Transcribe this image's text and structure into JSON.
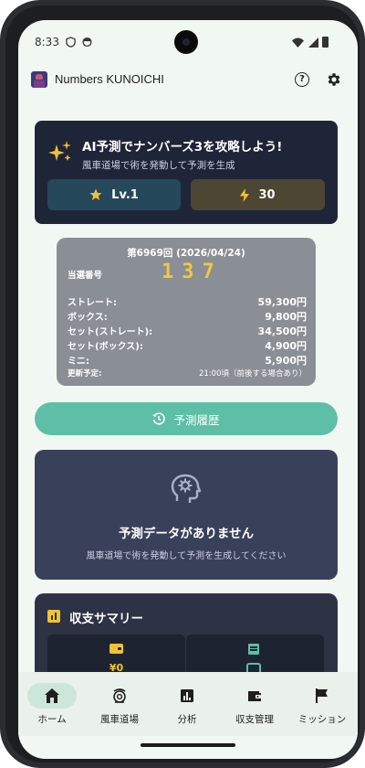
{
  "status_bar": {
    "time": "8:33"
  },
  "app_bar": {
    "title": "Numbers KUNOICHI",
    "help_icon": "help-circle-icon",
    "settings_icon": "gear-icon"
  },
  "hero": {
    "title": "AI予測でナンバーズ3を攻略しよう!",
    "subtitle": "風車道場で術を発動して予測を生成",
    "level_label": "Lv.1",
    "energy_value": "30",
    "colors": {
      "card": "#1f2538",
      "level_btn": "#25485a",
      "energy_btn": "#4c4633"
    }
  },
  "result": {
    "round": "第6969回 (2026/04/24)",
    "winning_label": "当選番号",
    "winning_number": "137",
    "prizes": [
      {
        "label": "ストレート:",
        "value": "59,300円"
      },
      {
        "label": "ボックス:",
        "value": "9,800円"
      },
      {
        "label": "セット(ストレート):",
        "value": "34,500円"
      },
      {
        "label": "セット(ボックス):",
        "value": "4,900円"
      },
      {
        "label": "ミニ:",
        "value": "5,900円"
      }
    ],
    "update_label": "更新予定:",
    "update_value": "21:00頃（前後する場合あり）",
    "number_color": "#f3c63f"
  },
  "history_button": {
    "label": "予測履歴",
    "icon": "history-icon",
    "color": "#5dbfa6"
  },
  "empty_state": {
    "title": "予測データがありません",
    "subtitle": "風車道場で術を発動して予測を生成してください",
    "icon": "head-gear-icon"
  },
  "summary": {
    "title": "収支サマリー",
    "left_value": "¥0",
    "icons": [
      "wallet-icon",
      "list-icon"
    ]
  },
  "bottom_nav": {
    "active_index": 0,
    "items": [
      {
        "label": "ホーム",
        "icon": "home-icon"
      },
      {
        "label": "風車道場",
        "icon": "dojo-icon"
      },
      {
        "label": "分析",
        "icon": "analytics-icon"
      },
      {
        "label": "収支管理",
        "icon": "wallet-icon"
      },
      {
        "label": "ミッション",
        "icon": "flag-icon"
      }
    ]
  }
}
